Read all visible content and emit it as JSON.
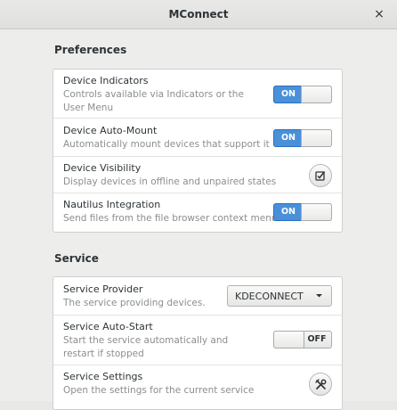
{
  "window": {
    "title": "MConnect",
    "close_glyph": "×"
  },
  "preferences": {
    "heading": "Preferences",
    "rows": [
      {
        "title": "Device Indicators",
        "subtitle": "Controls available via Indicators or the User Menu",
        "control": "switch",
        "state": "ON"
      },
      {
        "title": "Device Auto-Mount",
        "subtitle": "Automatically mount devices that support it",
        "control": "switch",
        "state": "ON"
      },
      {
        "title": "Device Visibility",
        "subtitle": "Display devices in offline and unpaired states",
        "control": "checkbox-button",
        "icon": "checkbox-icon"
      },
      {
        "title": "Nautilus Integration",
        "subtitle": "Send files from the file browser context menu",
        "control": "switch",
        "state": "ON"
      }
    ]
  },
  "service": {
    "heading": "Service",
    "rows": [
      {
        "title": "Service Provider",
        "subtitle": "The service providing devices.",
        "control": "combo",
        "value": "KDECONNECT"
      },
      {
        "title": "Service Auto-Start",
        "subtitle": "Start the service automatically and restart if stopped",
        "control": "switch",
        "state": "OFF"
      },
      {
        "title": "Service Settings",
        "subtitle": "Open the settings for the current service",
        "control": "button",
        "icon": "settings-tools-icon"
      }
    ]
  },
  "colors": {
    "accent": "#4a90d9",
    "card": "#ffffff",
    "background": "#ededec"
  }
}
